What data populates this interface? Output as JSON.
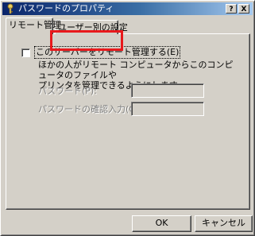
{
  "window": {
    "title": "パスワードのプロパティ",
    "help_button": "?",
    "close_button": "X"
  },
  "tabs": [
    {
      "label": "リモート管理",
      "active": true
    },
    {
      "label": "ユーザー別の設定",
      "active": false,
      "highlighted": true
    }
  ],
  "remote_admin": {
    "checkbox_label": "このサーバーをリモート管理する(E)",
    "checked": false,
    "description": "ほかの人がリモート コンピュータからこのコンピュータのファイルや\nプリンタを管理できるようにします。",
    "password_label": "パスワード(P):",
    "password_value": "",
    "password_confirm_label": "パスワードの確認入力(O):",
    "password_confirm_value": ""
  },
  "buttons": {
    "ok": "OK",
    "cancel": "キャンセル"
  },
  "colors": {
    "highlight_box": "#e8191c",
    "titlebar_start": "#0a246a",
    "titlebar_end": "#a6caf0",
    "face": "#d4d0c8"
  }
}
